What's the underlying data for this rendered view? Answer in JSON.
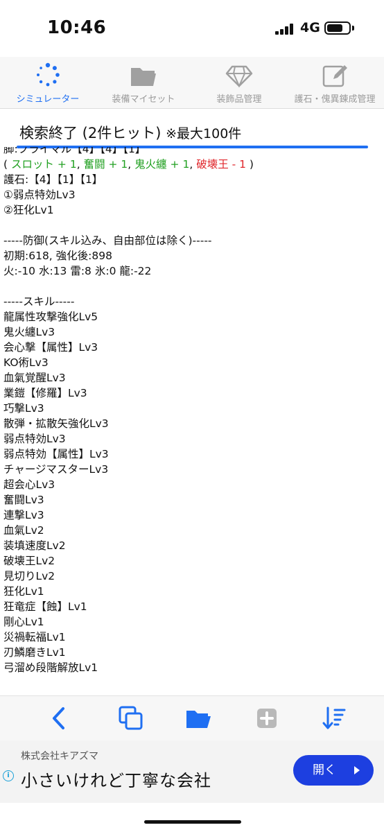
{
  "status_bar": {
    "time": "10:46",
    "network": "4G"
  },
  "tabs": [
    {
      "label": "シミュレーター",
      "icon": "spinner-icon",
      "active": true
    },
    {
      "label": "装備マイセット",
      "icon": "folder-icon",
      "active": false
    },
    {
      "label": "装飾品管理",
      "icon": "gem-icon",
      "active": false
    },
    {
      "label": "護石・傀異錬成管理",
      "icon": "edit-icon",
      "active": false
    }
  ],
  "search": {
    "title": "検索終了 (2件ヒット)",
    "note": "※最大100件"
  },
  "result": {
    "leg_line": "脚:ブライマル【4】【4】【1】",
    "bonus": {
      "open": "( ",
      "slot": "スロット + 1",
      "sep1": ", ",
      "challenger": "奮闘 + 1",
      "sep2": ", ",
      "oni": "鬼火纏 + 1",
      "sep3": ", ",
      "destroyer": "破壊王 - 1",
      "close": " )"
    },
    "talisman": "護石:【4】【1】【1】",
    "talisman_skills": [
      "①弱点特効Lv3",
      "②狂化Lv1"
    ],
    "defense_header": "-----防御(スキル込み、自由部位は除く)-----",
    "defense_values": "初期:618, 強化後:898",
    "resistances": "火:-10 水:13 雷:8 氷:0 龍:-22",
    "skills_header": "-----スキル-----",
    "skills": [
      "龍属性攻撃強化Lv5",
      "鬼火纏Lv3",
      "会心撃【属性】Lv3",
      "KO術Lv3",
      "血氣覚醒Lv3",
      "業鎧【修羅】Lv3",
      "巧撃Lv3",
      "散弾・拡散矢強化Lv3",
      "弱点特効Lv3",
      "弱点特効【属性】Lv3",
      "チャージマスターLv3",
      "超会心Lv3",
      "奮闘Lv3",
      "連撃Lv3",
      "血氣Lv2",
      "装填速度Lv2",
      "破壊王Lv2",
      "見切りLv2",
      "狂化Lv1",
      "狂竜症【蝕】Lv1",
      "剛心Lv1",
      "災禍転福Lv1",
      "刃鱗磨きLv1",
      "弓溜め段階解放Lv1"
    ]
  },
  "toolbar": [
    "back-icon",
    "copy-icon",
    "folder-open-icon",
    "add-icon",
    "sort-icon"
  ],
  "ad": {
    "company": "株式会社キアズマ",
    "headline": "小さいけれど丁寧な会社",
    "button_label": "開く",
    "info": "i"
  },
  "colors": {
    "accent": "#1f6ff2",
    "green": "#22a022",
    "red": "#e0262b",
    "ad_button": "#1d3fe0"
  }
}
